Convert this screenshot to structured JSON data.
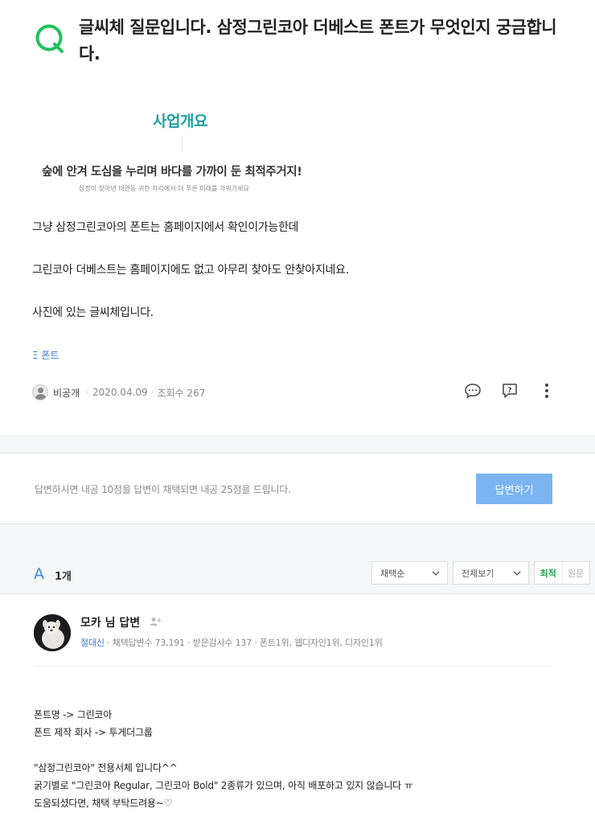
{
  "question": {
    "icon": "q-icon",
    "title": "글씨체 질문입니다. 삼정그린코아 더베스트 폰트가 무엇인지 궁금합니다.",
    "image": {
      "heading": "사업개요",
      "slogan": "숲에 안겨 도심을 누리며 바다를 가까이 둔 최적주거지!",
      "subtext": "삼정이 찾아낸 대연동 귀한 자리에서 더 푸른 미래를 가꿔가세요"
    },
    "body": [
      "그냥 삼정그린코아의 폰트는 홈페이지에서 확인이가능한데",
      "그린코아 더베스트는 홈페이지에도 없고 아무리 찾아도 안찾아지네요.",
      "사진에 있는 글씨체입니다."
    ],
    "tag": "Ξ 폰트",
    "meta": {
      "author": "비공개",
      "date": "2020.04.09",
      "views": "조회수 267"
    },
    "actions": [
      "comment-icon",
      "report-icon",
      "more-icon"
    ]
  },
  "answer_prompt": {
    "info": "답변하시면 내공 10점을 답변이 채택되면 내공 25점을 드립니다.",
    "button": "답변하기"
  },
  "answers_header": {
    "letter": "A",
    "count": "1개",
    "sort_selected": "채택순",
    "filter_selected": "전체보기",
    "toggle_latest": "최적",
    "toggle_original": "원문"
  },
  "answer": {
    "name": "모카 님 답변",
    "grade": "절대신",
    "stats": "· 채택답변수 73,191 · 받은감사수 137 · 폰트1위, 웹디자인1위, 디자인1위",
    "body": [
      "폰트명 -> 그린코아",
      "폰트 제작 회사 -> 투게더그룹",
      "",
      "\"삼정그린코아\" 전용서체 입니다^^",
      "굵기별로 \"그린코아 Regular, 그린코아 Bold\" 2종류가 있으며, 아직 배포하고 있지 않습니다 ㅠ",
      "도움되셨다면, 채택 부탁드려용~♡"
    ]
  },
  "colors": {
    "q_green": "#1ec15d",
    "answer_blue": "#3b88e8",
    "button_blue": "#7ab5f2",
    "heading_teal": "#1f9fa3",
    "latest_green": "#1ea54b"
  }
}
